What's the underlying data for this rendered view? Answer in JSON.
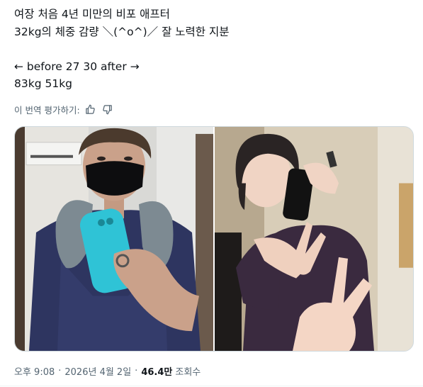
{
  "tweet": {
    "lines": [
      "여장 처음 4년 미만의 비포 애프터",
      "32kg의 체중 감량 ＼(^o^)／ 잘 노력한 지분",
      "",
      "← before 27 30 after →",
      "83kg 51kg"
    ]
  },
  "translation": {
    "prompt": "이 번역 평가하기:",
    "thumbs_up_icon": "thumbs-up-icon",
    "thumbs_down_icon": "thumbs-down-icon"
  },
  "media": {
    "photos": [
      {
        "alt": "before photo"
      },
      {
        "alt": "after photo"
      }
    ]
  },
  "meta": {
    "time": "오후 9:08",
    "date": "2026년 4월 2일",
    "separator": "·",
    "views": "46.4만",
    "views_label": "조회수"
  },
  "colors": {
    "text_primary": "#0f1419",
    "text_secondary": "#536471",
    "border": "#cfd9de"
  }
}
